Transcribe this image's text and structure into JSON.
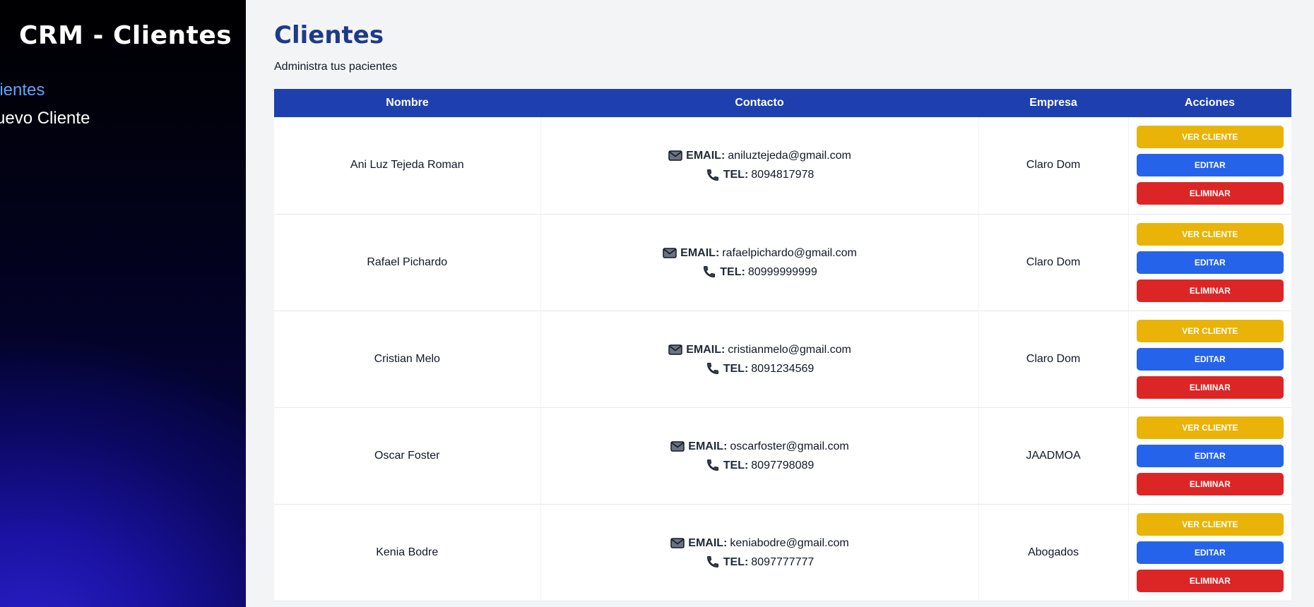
{
  "sidebar": {
    "brand": "CRM - Clientes",
    "items": [
      {
        "label": "lientes"
      },
      {
        "label": "uevo Cliente"
      }
    ]
  },
  "main": {
    "title": "Clientes",
    "subtitle": "Administra tus pacientes"
  },
  "table": {
    "headers": {
      "nombre": "Nombre",
      "contacto": "Contacto",
      "empresa": "Empresa",
      "acciones": "Acciones"
    },
    "email_label": "EMAIL:",
    "tel_label": "TEL:",
    "buttons": {
      "view": "Ver Cliente",
      "edit": "Editar",
      "delete": "Eliminar"
    },
    "rows": [
      {
        "nombre": "Ani Luz Tejeda Roman",
        "email": "aniluztejeda@gmail.com",
        "tel": "8094817978",
        "empresa": "Claro Dom"
      },
      {
        "nombre": "Rafael Pichardo",
        "email": "rafaelpichardo@gmail.com",
        "tel": "80999999999",
        "empresa": "Claro Dom"
      },
      {
        "nombre": "Cristian Melo",
        "email": "cristianmelo@gmail.com",
        "tel": "8091234569",
        "empresa": "Claro Dom"
      },
      {
        "nombre": "Oscar Foster",
        "email": "oscarfoster@gmail.com",
        "tel": "8097798089",
        "empresa": "JAADMOA"
      },
      {
        "nombre": "Kenia Bodre",
        "email": "keniabodre@gmail.com",
        "tel": "8097777777",
        "empresa": "Abogados"
      }
    ]
  },
  "colors": {
    "title": "#1e3a8a",
    "header_bg": "#1e40af",
    "btn_view": "#eab308",
    "btn_edit": "#2563eb",
    "btn_delete": "#dc2626",
    "nav_active": "#60a5fa"
  },
  "icons": {
    "email": "envelope-icon",
    "phone": "phone-icon"
  }
}
